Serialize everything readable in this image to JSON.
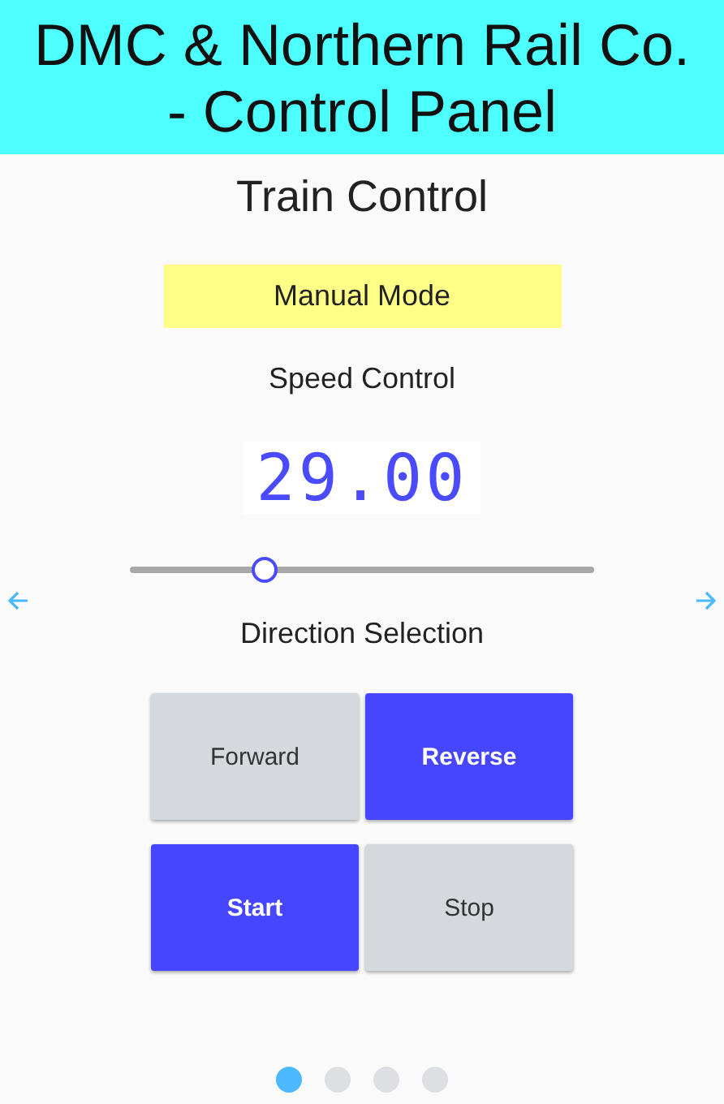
{
  "header": {
    "title": "DMC & Northern Rail Co. - Control Panel"
  },
  "page": {
    "title": "Train Control",
    "mode": "Manual Mode",
    "speed_label": "Speed Control",
    "speed_reading": "29.00",
    "speed_slider": {
      "level": 0.29
    },
    "direction_label": "Direction Selection"
  },
  "direction_buttons": [
    {
      "label": "Forward",
      "selected": false
    },
    {
      "label": "Reverse",
      "selected": true
    }
  ],
  "run_buttons": [
    {
      "label": "Start",
      "selected": true
    },
    {
      "label": "Stop",
      "selected": false
    }
  ],
  "pager": [
    {
      "selected": true
    },
    {
      "selected": false
    },
    {
      "selected": false
    },
    {
      "selected": false
    }
  ]
}
